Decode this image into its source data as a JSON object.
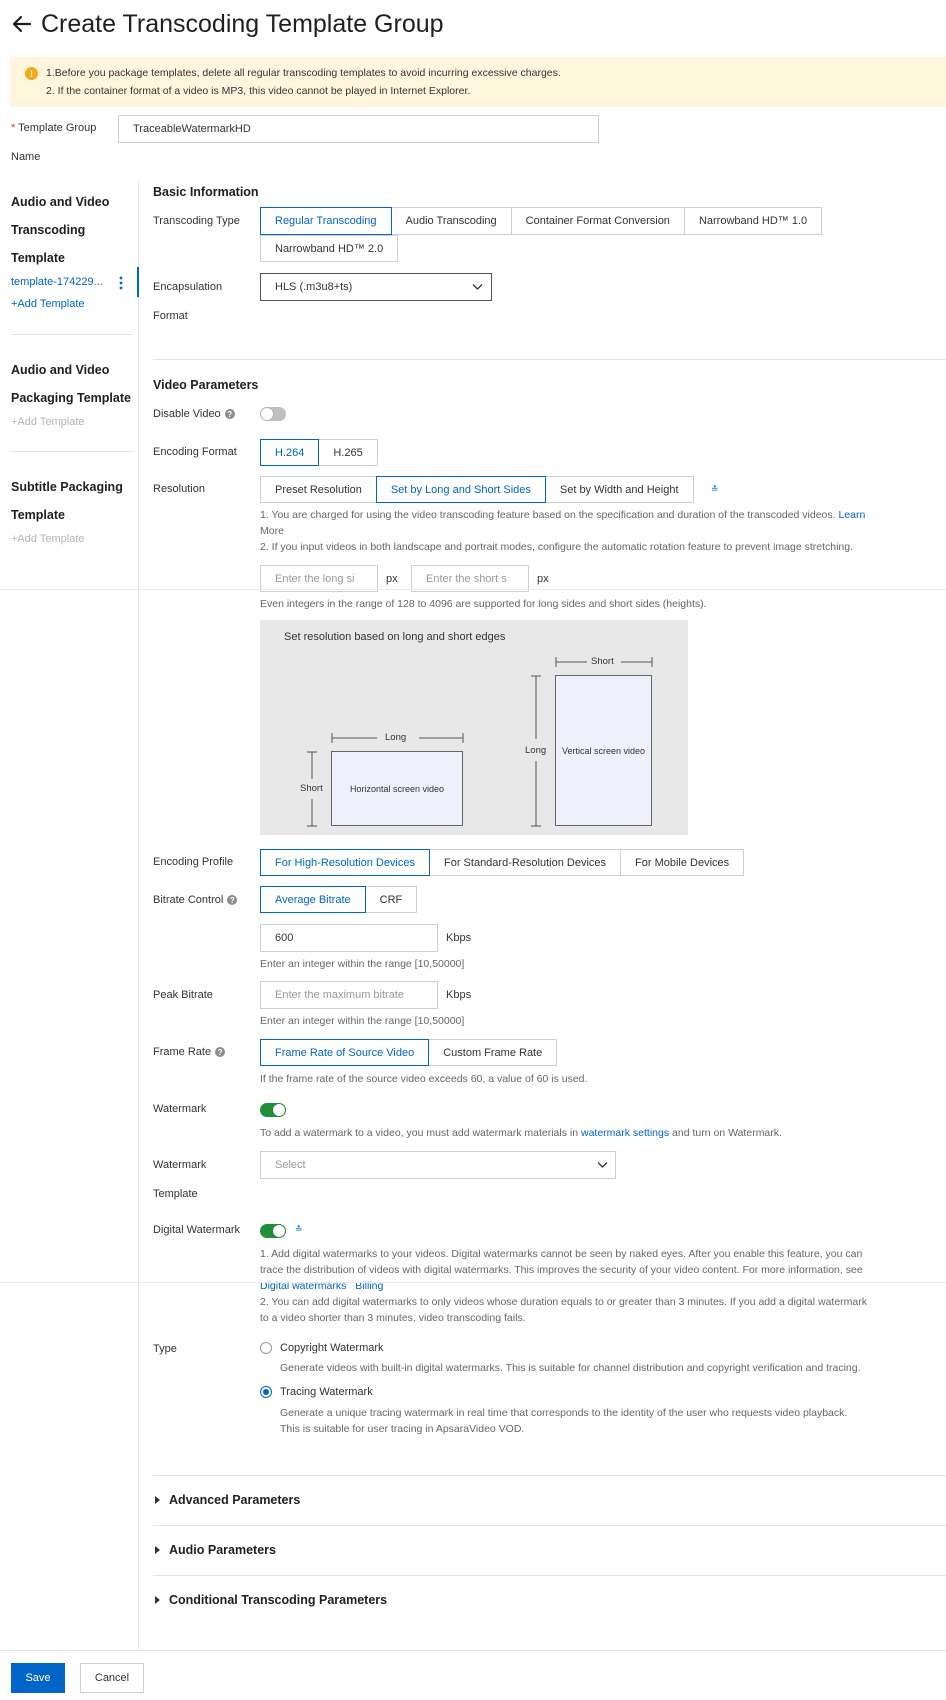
{
  "header": {
    "title": "Create Transcoding Template Group"
  },
  "notice": {
    "line1": "1.Before you package templates, delete all regular transcoding templates to avoid incurring excessive charges.",
    "line2": "2. If the container format of a video is MP3, this video cannot be played in Internet Explorer."
  },
  "group_name": {
    "required_mark": "*",
    "label_line1": "Template Group",
    "label_line2": "Name",
    "value": "TraceableWatermarkHD"
  },
  "sidebar": {
    "av_transcoding": {
      "line1": "Audio and Video",
      "line2": "Transcoding",
      "line3": "Template",
      "template_item": "template-174229...",
      "add": "+Add Template"
    },
    "av_packaging": {
      "line1": "Audio and Video",
      "line2": "Packaging Template",
      "add": "+Add Template"
    },
    "subtitle_packaging": {
      "line1": "Subtitle Packaging",
      "line2": "Template",
      "add": "+Add Template"
    }
  },
  "basic": {
    "title": "Basic Information",
    "transcoding_type_label": "Transcoding Type",
    "types": [
      "Regular Transcoding",
      "Audio Transcoding",
      "Container Format Conversion",
      "Narrowband HD™ 1.0",
      "Narrowband HD™ 2.0"
    ],
    "encapsulation_label_line1": "Encapsulation",
    "encapsulation_label_line2": "Format",
    "encapsulation_value": "HLS (.m3u8+ts)"
  },
  "video": {
    "title": "Video Parameters",
    "disable_video_label": "Disable Video",
    "disable_video_on": false,
    "encoding_format_label": "Encoding Format",
    "encoding_formats": [
      "H.264",
      "H.265"
    ],
    "resolution_label": "Resolution",
    "resolution_options": [
      "Preset Resolution",
      "Set by Long and Short Sides",
      "Set by Width and Height"
    ],
    "resolution_note1": "1. You are charged for using the video transcoding feature based on the specification and duration of the transcoded videos.",
    "resolution_note1_link_a": "Learn",
    "resolution_note1_link_b": "More",
    "resolution_note2": "2. If you input videos in both landscape and portrait modes, configure the automatic rotation feature to prevent image stretching.",
    "long_side_placeholder": "Enter the long si",
    "short_side_placeholder": "Enter the short s",
    "px_unit": "px",
    "range_hint": "Even integers in the range of 128 to 4096 are supported for long sides and short sides (heights).",
    "diagram": {
      "title": "Set resolution based on long and short edges",
      "long": "Long",
      "short": "Short",
      "horizontal": "Horizontal screen video",
      "vertical": "Vertical screen video"
    },
    "encoding_profile_label": "Encoding Profile",
    "encoding_profiles": [
      "For High-Resolution Devices",
      "For Standard-Resolution Devices",
      "For Mobile Devices"
    ],
    "bitrate_control_label": "Bitrate Control",
    "bitrate_modes": [
      "Average Bitrate",
      "CRF"
    ],
    "bitrate_value": "600",
    "kbps": "Kbps",
    "bitrate_hint": "Enter an integer within the range [10,50000]",
    "peak_bitrate_label": "Peak Bitrate",
    "peak_bitrate_placeholder": "Enter the maximum bitrate",
    "peak_bitrate_hint": "Enter an integer within the range [10,50000]",
    "frame_rate_label": "Frame Rate",
    "frame_rate_options": [
      "Frame Rate of Source Video",
      "Custom Frame Rate"
    ],
    "frame_rate_hint": "If the frame rate of the source video exceeds 60, a value of 60 is used.",
    "watermark_label": "Watermark",
    "watermark_on": true,
    "watermark_hint_a": "To add a watermark to a video, you must add watermark materials in",
    "watermark_hint_link": "watermark settings",
    "watermark_hint_b": "and turn on Watermark.",
    "watermark_template_label_line1": "Watermark",
    "watermark_template_label_line2": "Template",
    "watermark_template_placeholder": "Select",
    "digital_watermark_label": "Digital Watermark",
    "digital_watermark_on": true,
    "digital_note1_l1": "1. Add digital watermarks to your videos. Digital watermarks cannot be seen by naked eyes. After you enable this feature, you can",
    "digital_note1_l2": "trace the distribution of videos with digital watermarks. This improves the security of your video content. For more information, see",
    "digital_link1": "Digital watermarks",
    "digital_link2": "Billing",
    "digital_note2_l1": "2. You can add digital watermarks to only videos whose duration equals to or greater than 3 minutes. If you add a digital watermark",
    "digital_note2_l2": "to a video shorter than 3 minutes, video transcoding fails.",
    "type_label": "Type",
    "types": [
      {
        "label": "Copyright Watermark",
        "desc1": "Generate videos with built-in digital watermarks. This is suitable for channel distribution and copyright verification and tracing.",
        "desc2": "",
        "checked": false
      },
      {
        "label": "Tracing Watermark",
        "desc1": "Generate a unique tracing watermark in real time that corresponds to the identity of the user who requests video playback.",
        "desc2": "This is suitable for user tracing in ApsaraVideo VOD.",
        "checked": true
      }
    ]
  },
  "collapsibles": [
    "Advanced Parameters",
    "Audio Parameters",
    "Conditional Transcoding Parameters"
  ],
  "footer": {
    "save": "Save",
    "cancel": "Cancel"
  },
  "colors": {
    "primary": "#0064c8",
    "notice_bg": "#fff6dd",
    "toggle_on": "#1f8f3a"
  }
}
